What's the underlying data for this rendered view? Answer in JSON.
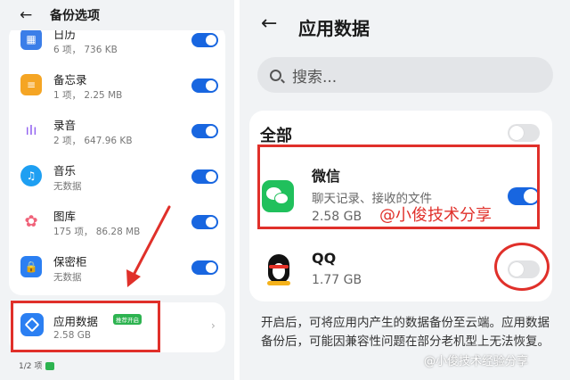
{
  "left": {
    "title": "备份选项",
    "items": [
      {
        "name": "日历",
        "sub": "6 项，  736 KB",
        "icon": "calendar-icon",
        "color": "#3b7ee8"
      },
      {
        "name": "备忘录",
        "sub": "1 项，  2.25 MB",
        "icon": "notes-icon",
        "color": "#f5a524"
      },
      {
        "name": "录音",
        "sub": "2 项，  647.96 KB",
        "icon": "recorder-icon",
        "color": "#8e5cf0"
      },
      {
        "name": "音乐",
        "sub": "无数据",
        "icon": "music-icon",
        "color": "#1e9ff2"
      },
      {
        "name": "图库",
        "sub": "175 项，  86.28 MB",
        "icon": "gallery-icon",
        "color": "#f0637a"
      },
      {
        "name": "保密柜",
        "sub": "无数据",
        "icon": "safe-icon",
        "color": "#2b7ff2"
      }
    ],
    "app_data": {
      "name": "应用数据",
      "badge": "推荐开启",
      "size": "2.58 GB"
    },
    "footer": "1/2 项"
  },
  "right": {
    "title": "应用数据",
    "search_placeholder": "搜索...",
    "all_label": "全部",
    "apps": [
      {
        "name": "微信",
        "desc": "聊天记录、接收的文件",
        "size": "2.58 GB",
        "enabled": true,
        "icon": "wechat-icon"
      },
      {
        "name": "QQ",
        "size": "1.77 GB",
        "enabled": false,
        "icon": "qq-icon"
      }
    ],
    "description": "开启后，可将应用内产生的数据备份至云端。应用数据备份后，可能因兼容性问题在部分老机型上无法恢复。",
    "watermark": "@小俊技术分享",
    "watermark2": "@小俊技术经验分享"
  },
  "colors": {
    "accent": "#1866e0",
    "annotation": "#e0302a",
    "wechat": "#20c05c"
  }
}
